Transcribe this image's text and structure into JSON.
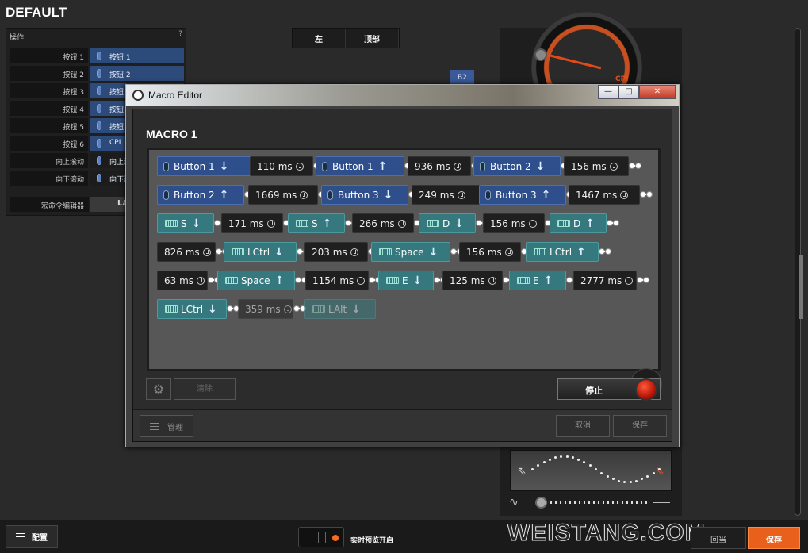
{
  "app": {
    "profile_title": "DEFAULT"
  },
  "bindings": {
    "header": "操作",
    "help": "?",
    "rows": [
      {
        "key": "按钮 1",
        "value": "按钮 1"
      },
      {
        "key": "按钮 2",
        "value": "按钮 2"
      },
      {
        "key": "按钮 3",
        "value": "按钮"
      },
      {
        "key": "按钮 4",
        "value": "按钮"
      },
      {
        "key": "按钮 5",
        "value": "按钮"
      },
      {
        "key": "按钮 6",
        "value": "CPI"
      },
      {
        "key": "向上滚动",
        "value": "向上滚"
      },
      {
        "key": "向下滚动",
        "value": "向下滚"
      }
    ],
    "macro_key": "宏命令编辑器",
    "macro_val": "LA"
  },
  "view_tabs": [
    "左",
    "顶部"
  ],
  "b2_tag": "B2",
  "cpi": {
    "label": "CPI"
  },
  "bottom": {
    "config_label": "配置",
    "live_preview_label": "实时预览开启",
    "revert_label": "回当",
    "save_label": "保存",
    "watermark": "WEISTANG.COM"
  },
  "macro_editor": {
    "title": "Macro Editor",
    "macro_name": "MACRO 1",
    "win_buttons": {
      "minimize": "—",
      "maximize": "□",
      "close": "✕"
    },
    "steps": [
      {
        "kind": "mouse",
        "label": "Button 1",
        "dir": "down"
      },
      {
        "kind": "delay",
        "label": "110 ms"
      },
      {
        "kind": "mouse",
        "label": "Button 1",
        "dir": "up"
      },
      {
        "kind": "delay",
        "label": "936 ms"
      },
      {
        "kind": "mouse",
        "label": "Button 2",
        "dir": "down"
      },
      {
        "kind": "delay",
        "label": "156 ms"
      },
      {
        "kind": "mouse",
        "label": "Button 2",
        "dir": "up"
      },
      {
        "kind": "delay",
        "label": "1669 ms"
      },
      {
        "kind": "mouse",
        "label": "Button 3",
        "dir": "down"
      },
      {
        "kind": "delay",
        "label": "249 ms"
      },
      {
        "kind": "mouse",
        "label": "Button 3",
        "dir": "up"
      },
      {
        "kind": "delay",
        "label": "1467 ms"
      },
      {
        "kind": "key",
        "label": "S",
        "dir": "down"
      },
      {
        "kind": "delay",
        "label": "171 ms"
      },
      {
        "kind": "key",
        "label": "S",
        "dir": "up"
      },
      {
        "kind": "delay",
        "label": "266 ms"
      },
      {
        "kind": "key",
        "label": "D",
        "dir": "down"
      },
      {
        "kind": "delay",
        "label": "156 ms"
      },
      {
        "kind": "key",
        "label": "D",
        "dir": "up"
      },
      {
        "kind": "delay",
        "label": "826 ms"
      },
      {
        "kind": "key",
        "label": "LCtrl",
        "dir": "down"
      },
      {
        "kind": "delay",
        "label": "203 ms"
      },
      {
        "kind": "key",
        "label": "Space",
        "dir": "down"
      },
      {
        "kind": "delay",
        "label": "156 ms"
      },
      {
        "kind": "key",
        "label": "LCtrl",
        "dir": "up"
      },
      {
        "kind": "delay",
        "label": "63 ms"
      },
      {
        "kind": "key",
        "label": "Space",
        "dir": "up"
      },
      {
        "kind": "delay",
        "label": "1154 ms"
      },
      {
        "kind": "key",
        "label": "E",
        "dir": "down"
      },
      {
        "kind": "delay",
        "label": "125 ms"
      },
      {
        "kind": "key",
        "label": "E",
        "dir": "up"
      },
      {
        "kind": "delay",
        "label": "2777 ms"
      },
      {
        "kind": "key",
        "label": "LCtrl",
        "dir": "down"
      },
      {
        "kind": "delay",
        "label": "359 ms",
        "ghost": true
      },
      {
        "kind": "key",
        "label": "LAlt",
        "dir": "down",
        "ghost": true
      }
    ],
    "clear_label": "清除",
    "stop_label": "停止",
    "manage_label": "管理",
    "cancel_label": "取消",
    "save_label": "保存"
  }
}
